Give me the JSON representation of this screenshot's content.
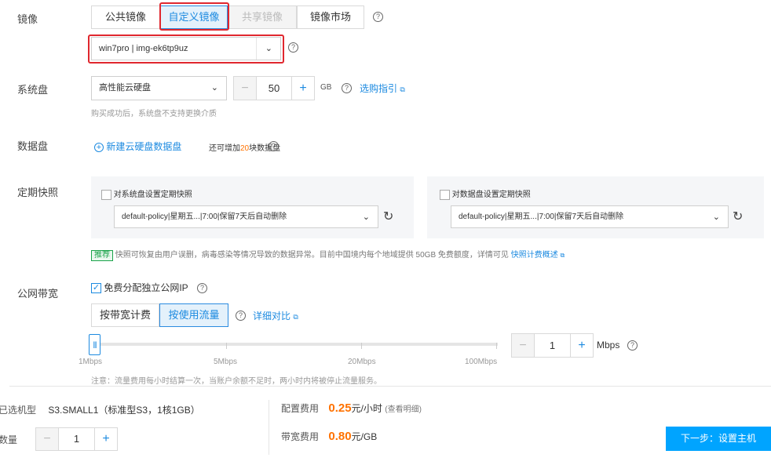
{
  "image_section": {
    "label": "镜像",
    "tabs": [
      {
        "label": "公共镜像",
        "state": "normal"
      },
      {
        "label": "自定义镜像",
        "state": "active"
      },
      {
        "label": "共享镜像",
        "state": "disabled"
      },
      {
        "label": "镜像市场",
        "state": "normal"
      }
    ],
    "selected_image": "win7pro | img-ek6tp9uz"
  },
  "system_disk": {
    "label": "系统盘",
    "type": "高性能云硬盘",
    "size": "50",
    "unit": "GB",
    "guide_link": "选购指引",
    "note": "购买成功后，系统盘不支持更换介质"
  },
  "data_disk": {
    "label": "数据盘",
    "add_link": "新建云硬盘数据盘",
    "remaining_prefix": "还可增加",
    "remaining_count": "20",
    "remaining_suffix": "块数据盘"
  },
  "snapshot": {
    "label": "定期快照",
    "system_checkbox_label": "对系统盘设置定期快照",
    "system_policy": "default-policy|星期五...|7:00|保留7天后自动删除",
    "data_checkbox_label": "对数据盘设置定期快照",
    "data_policy": "default-policy|星期五...|7:00|保留7天后自动删除",
    "recommend_badge": "推荐",
    "recommend_text": "快照可恢复由用户误删，病毒感染等情况导致的数据异常。目前中国境内每个地域提供 50GB 免费额度，详情可见",
    "recommend_link": "快照计费概述"
  },
  "bandwidth": {
    "label": "公网带宽",
    "free_ip_label": "免费分配独立公网IP",
    "billing_tabs": [
      {
        "label": "按带宽计费",
        "state": "normal"
      },
      {
        "label": "按使用流量",
        "state": "active"
      }
    ],
    "compare_link": "详细对比",
    "slider_ticks": [
      "1Mbps",
      "5Mbps",
      "20Mbps",
      "100Mbps"
    ],
    "slider_level": 1,
    "value": "1",
    "unit": "Mbps",
    "note": "注意：流量费用每小时结算一次，当账户余额不足时，两小时内将被停止流量服务。"
  },
  "footer": {
    "model_label": "已选机型",
    "model_value": "S3.SMALL1（标准型S3，1核1GB）",
    "quantity_label": "数量",
    "quantity_value": "1",
    "config_fee_label": "配置费用",
    "config_fee_price": "0.25",
    "config_fee_unit": "元/小时",
    "config_fee_detail": "(查看明细)",
    "bandwidth_fee_label": "带宽费用",
    "bandwidth_fee_price": "0.80",
    "bandwidth_fee_unit": "元/GB",
    "next_button": "下一步：设置主机"
  },
  "colors": {
    "accent": "#1c8ae0",
    "price": "#ff7200",
    "highlight_box": "#e0272e",
    "next_button": "#00a4ff"
  }
}
